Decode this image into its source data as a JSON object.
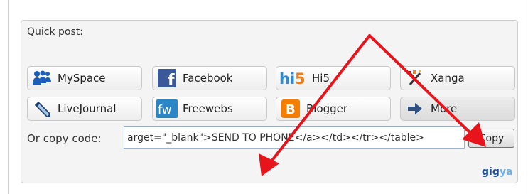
{
  "widget": {
    "title": "Quick post:",
    "buttons": [
      {
        "label": "MySpace",
        "icon": "myspace-icon"
      },
      {
        "label": "Facebook",
        "icon": "facebook-icon"
      },
      {
        "label": "Hi5",
        "icon": "hi5-icon"
      },
      {
        "label": "Xanga",
        "icon": "xanga-icon"
      },
      {
        "label": "LiveJournal",
        "icon": "livejournal-icon"
      },
      {
        "label": "Freewebs",
        "icon": "freewebs-icon"
      },
      {
        "label": "Blogger",
        "icon": "blogger-icon"
      },
      {
        "label": "More",
        "icon": "arrow-right-icon"
      }
    ],
    "copy_code": {
      "label": "Or copy code:",
      "value": "arget=\"_blank\">SEND TO PHONE</a></td></tr></table>",
      "button": "Copy"
    },
    "brand": {
      "part1": "gig",
      "part2": "ya"
    }
  },
  "colors": {
    "annotation_arrow": "#e8141b",
    "facebook": "#3b5998",
    "hi5": "#2a8ad6",
    "blogger": "#f57d00",
    "freewebs": "#2b84c6"
  }
}
